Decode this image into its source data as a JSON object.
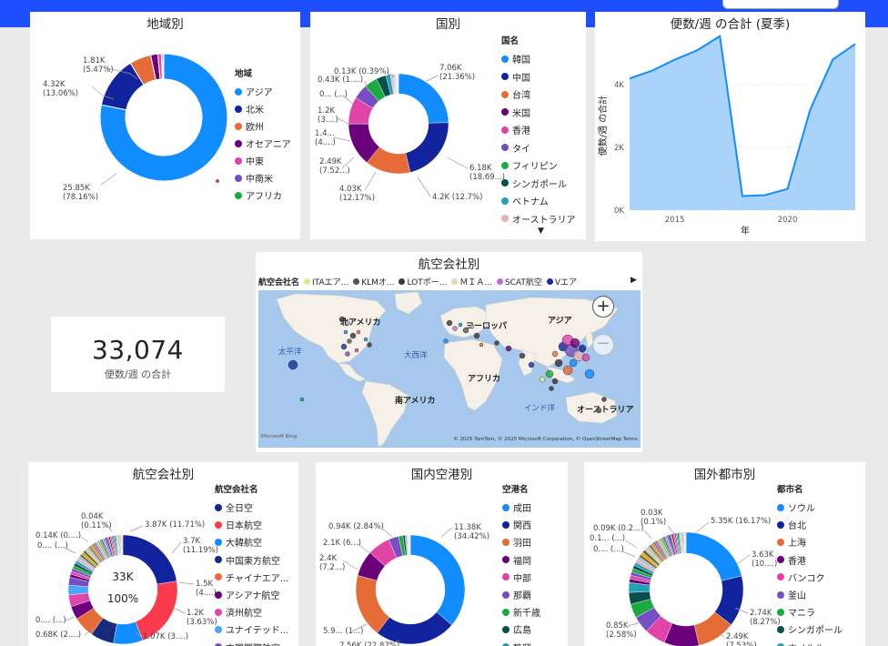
{
  "kpi": {
    "value": "33,074",
    "label": "便数/週 の合計"
  },
  "region": {
    "title": "地域別",
    "legend_title": "地域",
    "items": [
      {
        "label": "アジア",
        "color": "#118dff"
      },
      {
        "label": "北米",
        "color": "#12239e"
      },
      {
        "label": "欧州",
        "color": "#e66c37"
      },
      {
        "label": "オセアニア",
        "color": "#6b007b"
      },
      {
        "label": "中東",
        "color": "#e044a7"
      },
      {
        "label": "中南米",
        "color": "#744ec2"
      },
      {
        "label": "アフリカ",
        "color": "#1aab40"
      }
    ],
    "labels": {
      "asia": "25.85K\n(78.16%)",
      "na": "4.32K\n(13.06%)",
      "eu": "1.81K\n(5.47%)"
    }
  },
  "country": {
    "title": "国別",
    "legend_title": "国名",
    "items": [
      {
        "label": "韓国",
        "color": "#118dff"
      },
      {
        "label": "中国",
        "color": "#12239e"
      },
      {
        "label": "台湾",
        "color": "#e66c37"
      },
      {
        "label": "米国",
        "color": "#6b007b"
      },
      {
        "label": "香港",
        "color": "#e044a7"
      },
      {
        "label": "タイ",
        "color": "#744ec2"
      },
      {
        "label": "フィリピン",
        "color": "#1aab40"
      },
      {
        "label": "シンガポール",
        "color": "#0b4e4e"
      },
      {
        "label": "ベトナム",
        "color": "#22a0b5"
      },
      {
        "label": "オーストラリア",
        "color": "#e5b1b5"
      }
    ],
    "labels": [
      "7.06K\n(21.36%)",
      "6.18K\n(18.69...)",
      "4.2K (12.7%)",
      "4.03K\n(12.17%)",
      "2.49K\n(7.52...)",
      "1.4...\n(4....)",
      "1.2K\n(3....)",
      "0... (...)",
      "0.43K (1....)",
      "0.13K (0.39%)"
    ]
  },
  "trend": {
    "title": "便数/週 の合計 (夏季)",
    "xlabel": "年",
    "ylabel": "便数/週 の合計",
    "yticks": [
      "4K",
      "2K",
      "0K"
    ],
    "xticks": [
      "2015",
      "2020"
    ]
  },
  "airline": {
    "title": "航空会社別",
    "legend_title": "航空会社名",
    "center_value": "33K",
    "center_pct": "100%",
    "items": [
      {
        "label": "全日空",
        "color": "#12239e"
      },
      {
        "label": "日本航空",
        "color": "#fd3b4f"
      },
      {
        "label": "大韓航空",
        "color": "#118dff"
      },
      {
        "label": "中国東方航空",
        "color": "#1a2a7a"
      },
      {
        "label": "チャイナエア...",
        "color": "#e66c37"
      },
      {
        "label": "アシアナ航空",
        "color": "#6b007b"
      },
      {
        "label": "済州航空",
        "color": "#e044a7"
      },
      {
        "label": "ユナイテッド...",
        "color": "#4aa3ff"
      },
      {
        "label": "中国国際航空",
        "color": "#744ec2"
      }
    ],
    "labels": [
      "3.87K (11.71%)",
      "3.7K\n(11.19%)",
      "1.5K\n(4....)",
      "1.2K\n(3.63%)",
      "1.07K (3....)",
      "0.68K (2....)",
      "0.... (...)",
      "0.... (...)",
      "0.14K (0....)",
      "0.04K\n(0.11%)"
    ]
  },
  "domestic": {
    "title": "国内空港別",
    "legend_title": "空港名",
    "items": [
      {
        "label": "成田",
        "color": "#118dff"
      },
      {
        "label": "関西",
        "color": "#12239e"
      },
      {
        "label": "羽田",
        "color": "#e66c37"
      },
      {
        "label": "福岡",
        "color": "#6b007b"
      },
      {
        "label": "中部",
        "color": "#e044a7"
      },
      {
        "label": "那覇",
        "color": "#744ec2"
      },
      {
        "label": "新千歳",
        "color": "#1aab40"
      },
      {
        "label": "広島",
        "color": "#0b4e4e"
      },
      {
        "label": "静岡",
        "color": "#22a0b5"
      }
    ],
    "labels": [
      "11.38K\n(34.42%)",
      "7.56K (22.87%)",
      "5.9... (1...)",
      "2.4K\n(7.2...)",
      "2.1K (6...)",
      "0.94K (2.84%)"
    ]
  },
  "city": {
    "title": "国外都市別",
    "legend_title": "都市名",
    "items": [
      {
        "label": "ソウル",
        "color": "#118dff"
      },
      {
        "label": "台北",
        "color": "#12239e"
      },
      {
        "label": "上海",
        "color": "#e66c37"
      },
      {
        "label": "香港",
        "color": "#6b007b"
      },
      {
        "label": "バンコク",
        "color": "#e044a7"
      },
      {
        "label": "釜山",
        "color": "#744ec2"
      },
      {
        "label": "マニラ",
        "color": "#1aab40"
      },
      {
        "label": "シンガポール",
        "color": "#0b4e4e"
      },
      {
        "label": "ホノルル",
        "color": "#22a0b5"
      }
    ],
    "labels": [
      "5.35K (16.17%)",
      "3.63K\n(10....)",
      "2.74K\n(8.27%)",
      "2.49K\n(7.53%)",
      "0.85K\n(2.58%)",
      "0.... (...)",
      "0.1... (...)",
      "0.09K (0.2...)",
      "0.03K\n(0.1%)"
    ]
  },
  "map": {
    "title": "航空会社別",
    "legend_title": "航空会社名",
    "legend": [
      {
        "label": "ITAエア...",
        "color": "#d9f08a"
      },
      {
        "label": "KLMオ...",
        "color": "#555555"
      },
      {
        "label": "LOTポー...",
        "color": "#3a3a3a"
      },
      {
        "label": "ＭＩＡ...",
        "color": "#dcdcb4"
      },
      {
        "label": "SCAT航空",
        "color": "#c06bd6"
      },
      {
        "label": "Vエア",
        "color": "#1a2aa0"
      }
    ],
    "regions": {
      "na": "北アメリカ",
      "eu": "ヨーロッパ",
      "asia": "アジア",
      "pac": "太平洋",
      "atl": "大西洋",
      "af": "アフリカ",
      "sa": "南アメリカ",
      "io": "インド洋",
      "oc": "オーストラリア"
    },
    "credit": "© 2025 TomTom, © 2025 Microsoft Corporation, © OpenStreetMap  Terms",
    "brand": "Microsoft Bing"
  },
  "chart_data": [
    {
      "type": "pie",
      "title": "地域別",
      "categories": [
        "アジア",
        "北米",
        "欧州",
        "オセアニア",
        "中東",
        "中南米",
        "アフリカ"
      ],
      "values": [
        25850,
        4320,
        1810,
        600,
        300,
        120,
        74
      ]
    },
    {
      "type": "pie",
      "title": "国別",
      "categories": [
        "韓国",
        "中国",
        "台湾",
        "米国",
        "香港",
        "タイ",
        "フィリピン",
        "シンガポール",
        "ベトナム",
        "オーストラリア"
      ],
      "values": [
        7060,
        6180,
        4200,
        4030,
        2490,
        1400,
        1200,
        900,
        430,
        130
      ]
    },
    {
      "type": "area",
      "title": "便数/週 の合計 (夏季)",
      "x": [
        2013,
        2014,
        2015,
        2016,
        2017,
        2018,
        2019,
        2020,
        2021,
        2022,
        2023
      ],
      "values": [
        4200,
        4450,
        4800,
        5100,
        5550,
        450,
        480,
        680,
        3200,
        4800,
        5300
      ],
      "xlabel": "年",
      "ylabel": "便数/週 の合計",
      "ylim": [
        0,
        5600
      ]
    },
    {
      "type": "pie",
      "title": "航空会社別",
      "categories": [
        "全日空",
        "日本航空",
        "大韓航空",
        "中国東方航空",
        "チャイナエア...",
        "アシアナ航空",
        "済州航空",
        "ユナイテッド...",
        "中国国際航空"
      ],
      "values": [
        3870,
        3700,
        1500,
        1200,
        1070,
        680,
        600,
        500,
        400
      ]
    },
    {
      "type": "pie",
      "title": "国内空港別",
      "categories": [
        "成田",
        "関西",
        "羽田",
        "福岡",
        "中部",
        "那覇",
        "新千歳",
        "広島",
        "静岡"
      ],
      "values": [
        11380,
        7560,
        5900,
        2400,
        2100,
        940,
        400,
        200,
        100
      ]
    },
    {
      "type": "pie",
      "title": "国外都市別",
      "categories": [
        "ソウル",
        "台北",
        "上海",
        "香港",
        "バンコク",
        "釜山",
        "マニラ",
        "シンガポール",
        "ホノルル"
      ],
      "values": [
        5350,
        3630,
        2740,
        2490,
        1500,
        1200,
        1000,
        850,
        700
      ]
    }
  ]
}
